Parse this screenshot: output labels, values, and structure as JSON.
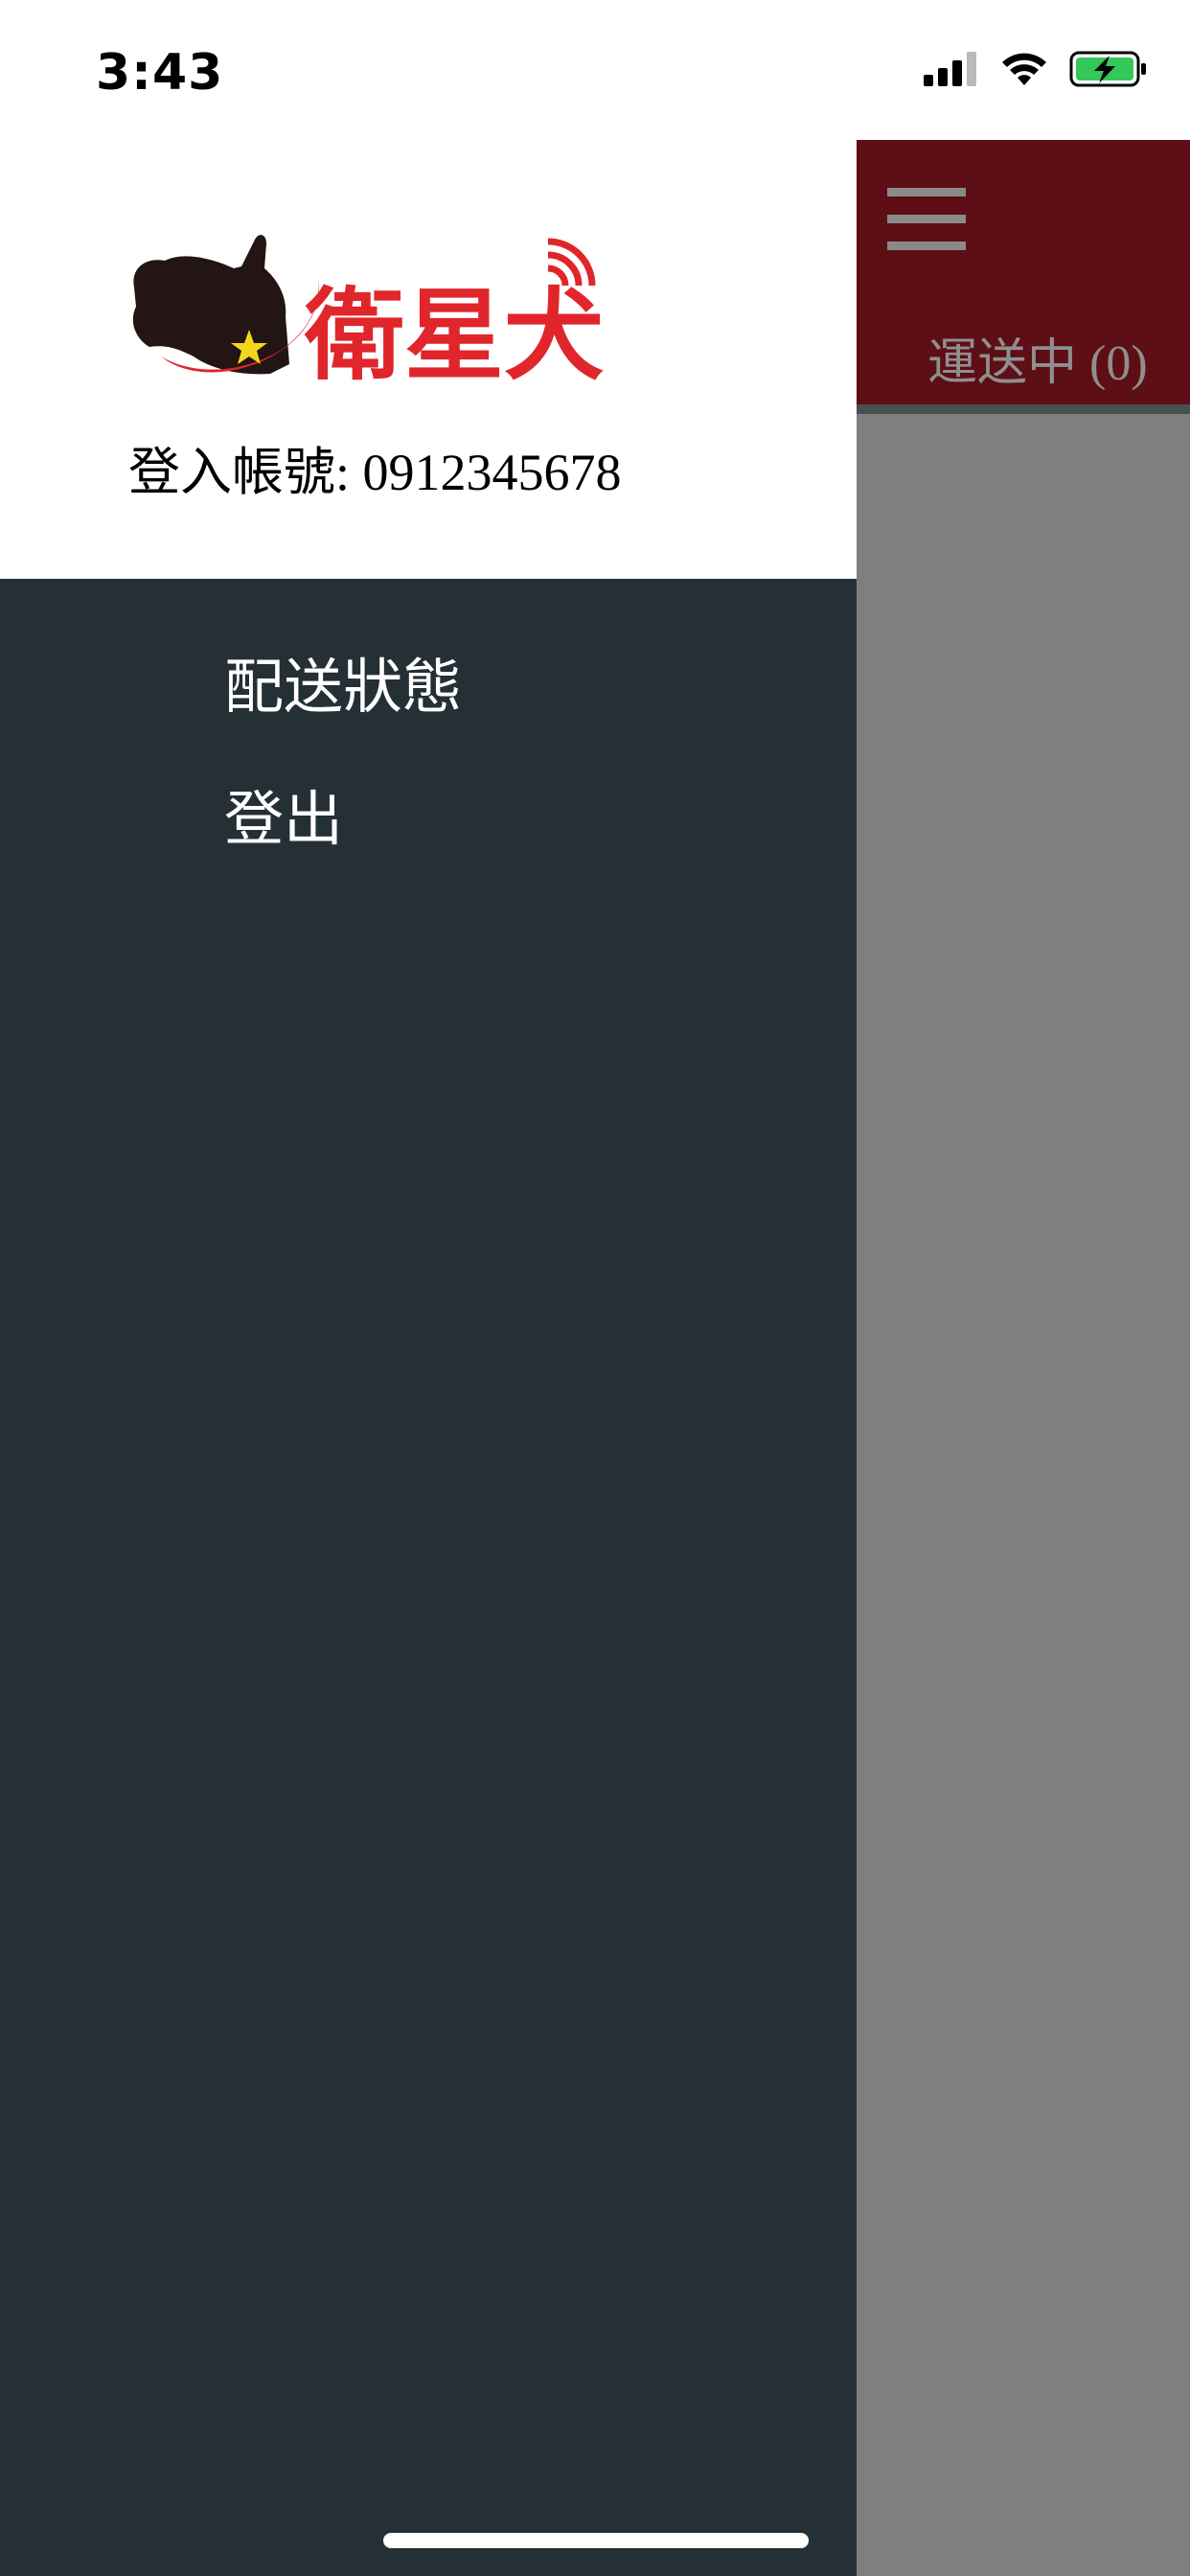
{
  "status_bar": {
    "time": "3:43",
    "icons": [
      "cellular-signal-icon",
      "wifi-icon",
      "battery-charging-icon"
    ]
  },
  "app": {
    "tab_label": "運送中 (0)",
    "colors": {
      "header": "#5e0e15",
      "body_overlay": "#7f7f7f"
    }
  },
  "drawer": {
    "logo_text": "衛星犬",
    "account_label": "登入帳號: 0912345678",
    "menu": [
      {
        "label": "配送狀態"
      },
      {
        "label": "登出"
      }
    ],
    "colors": {
      "header": "#ffffff",
      "menu_bg": "#252f36",
      "brand_red": "#e0262b"
    }
  }
}
